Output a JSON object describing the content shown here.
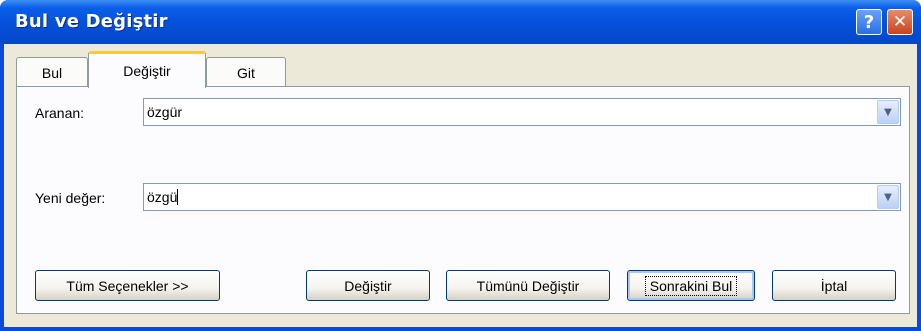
{
  "window": {
    "title": "Bul ve Değiştir"
  },
  "tabs": [
    {
      "label": "Bul",
      "active": false
    },
    {
      "label": "Değiştir",
      "active": true
    },
    {
      "label": "Git",
      "active": false
    }
  ],
  "find": {
    "label": "Aranan:",
    "value": "özgür"
  },
  "replace": {
    "label": "Yeni değer:",
    "value": "özgü"
  },
  "buttons": {
    "more": "Tüm Seçenekler >>",
    "replace": "Değiştir",
    "replace_all": "Tümünü Değiştir",
    "find_next": "Sonrakini Bul",
    "cancel": "İptal"
  },
  "icons": {
    "help": "?",
    "close": "✕",
    "dropdown": "▼"
  },
  "colors": {
    "title_bar": "#0a5ee8",
    "active_tab_accent": "#ffc83c",
    "dialog_bg": "#ece9d8"
  }
}
